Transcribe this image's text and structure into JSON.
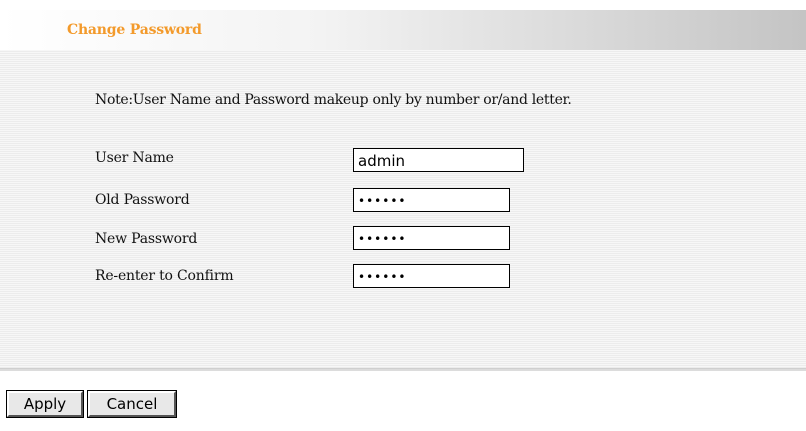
{
  "header": {
    "title": "Change Password"
  },
  "note": "Note:User Name and Password makeup only by number or/and letter.",
  "form": {
    "username_label": "User Name",
    "username_value": "admin",
    "old_password_label": "Old Password",
    "old_password_value": "••••••",
    "new_password_label": "New Password",
    "new_password_value": "••••••",
    "confirm_label": "Re-enter to Confirm",
    "confirm_value": "••••••"
  },
  "buttons": {
    "apply_label": "Apply",
    "cancel_label": "Cancel"
  },
  "colors": {
    "title": "#f39a2b"
  }
}
